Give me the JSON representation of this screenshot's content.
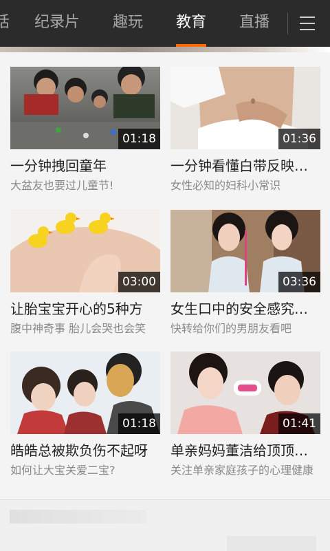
{
  "tabs": [
    {
      "label": "话"
    },
    {
      "label": "纪录片"
    },
    {
      "label": "趣玩"
    },
    {
      "label": "教育"
    },
    {
      "label": "直播"
    }
  ],
  "active_tab": "教育",
  "accent_color": "#ff6a00",
  "videos": [
    {
      "title": "一分钟拽回童年",
      "subtitle": "大盆友也要过儿童节!",
      "duration": "01:18"
    },
    {
      "title": "一分钟看懂白带反映的健康",
      "subtitle": "女性必知的妇科小常识",
      "duration": "01:36"
    },
    {
      "title": "让胎宝宝开心的5种方",
      "subtitle": "腹中神奇事 胎儿会哭也会笑",
      "duration": "03:00"
    },
    {
      "title": "女生口中的安全感究竟是什么",
      "subtitle": "快转给你们的男朋友看吧",
      "duration": "03:36"
    },
    {
      "title": "皓皓总被欺负伤不起呀",
      "subtitle": "如何让大宝关爱二宝?",
      "duration": "01:18"
    },
    {
      "title": "单亲妈妈董洁给顶顶的爱",
      "subtitle": "关注单亲家庭孩子的心理健康",
      "duration": "01:41"
    }
  ]
}
